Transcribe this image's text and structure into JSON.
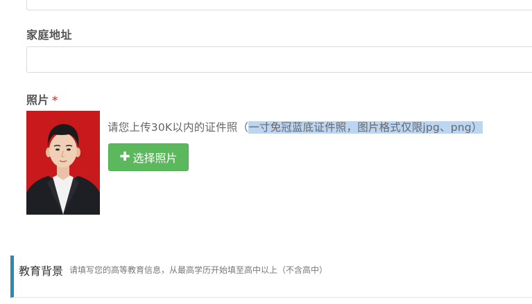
{
  "form": {
    "address_label": "家庭地址",
    "address_value": "",
    "photo_label": "照片",
    "required_mark": "*",
    "photo_hint_before": "请您上传30K以内的证件照（",
    "photo_hint_selected": "一寸免冠蓝底证件照，图片格式仅限jpg、png）",
    "upload_button": "选择照片",
    "upload_icon": "plus-icon"
  },
  "section": {
    "title": "教育背景",
    "subtitle": "请填写您的高等教育信息，从最高学历开始填至高中以上（不含高中）"
  },
  "colors": {
    "button_bg": "#5cb85c",
    "section_accent": "#2a8ab0",
    "photo_bg": "#c8191c",
    "required": "#d9534f",
    "selection_highlight": "#bcd6f2"
  }
}
